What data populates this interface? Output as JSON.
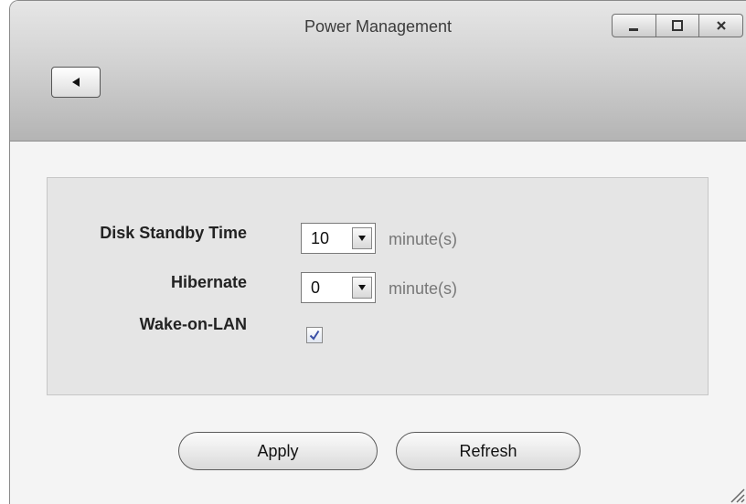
{
  "window": {
    "title": "Power Management",
    "controls": [
      "minimize-icon",
      "maximize-icon",
      "close-icon"
    ]
  },
  "toolbar": {
    "back_icon": "back-arrow-icon"
  },
  "form": {
    "disk_standby": {
      "label": "Disk Standby Time",
      "value": "10",
      "unit": "minute(s)"
    },
    "hibernate": {
      "label": "Hibernate",
      "value": "0",
      "unit": "minute(s)"
    },
    "wake_on_lan": {
      "label": "Wake-on-LAN",
      "checked": true
    }
  },
  "buttons": {
    "apply": "Apply",
    "refresh": "Refresh"
  }
}
